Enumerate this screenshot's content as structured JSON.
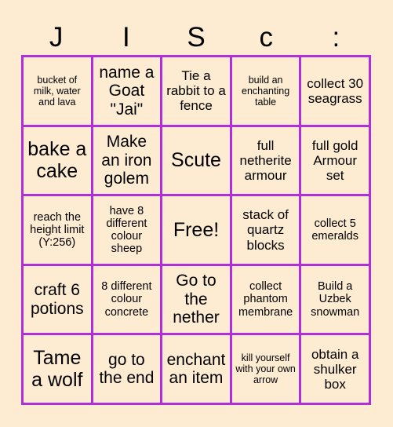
{
  "header": {
    "letters": [
      "J",
      "I",
      "S",
      "c",
      ":"
    ]
  },
  "grid": {
    "columns": 5,
    "rows": 5,
    "border_color": "#b02fd8",
    "background_color": "#fdecd2",
    "text_color": "#000000",
    "cells": [
      {
        "text": "bucket of milk, water and lava",
        "size": "fs-xs"
      },
      {
        "text": "name a Goat \"Jai\"",
        "size": "fs-l"
      },
      {
        "text": "Tie a rabbit to a fence",
        "size": "fs-m"
      },
      {
        "text": "build an enchanting table",
        "size": "fs-xs"
      },
      {
        "text": "collect 30 seagrass",
        "size": "fs-m"
      },
      {
        "text": "bake a cake",
        "size": "fs-xl"
      },
      {
        "text": "Make an iron golem",
        "size": "fs-l"
      },
      {
        "text": "Scute",
        "size": "fs-xl"
      },
      {
        "text": "full netherite armour",
        "size": "fs-m"
      },
      {
        "text": "full gold Armour set",
        "size": "fs-m"
      },
      {
        "text": "reach the height limit (Y:256)",
        "size": "fs-s"
      },
      {
        "text": "have 8 different colour sheep",
        "size": "fs-s"
      },
      {
        "text": "Free!",
        "size": "fs-xl"
      },
      {
        "text": "stack of quartz blocks",
        "size": "fs-m"
      },
      {
        "text": "collect 5 emeralds",
        "size": "fs-s"
      },
      {
        "text": "craft 6 potions",
        "size": "fs-l"
      },
      {
        "text": "8 different colour concrete",
        "size": "fs-s"
      },
      {
        "text": "Go to the nether",
        "size": "fs-l"
      },
      {
        "text": "collect phantom membrane",
        "size": "fs-s"
      },
      {
        "text": "Build a Uzbek snowman",
        "size": "fs-s"
      },
      {
        "text": "Tame a wolf",
        "size": "fs-xl"
      },
      {
        "text": "go to the end",
        "size": "fs-l"
      },
      {
        "text": "enchant an item",
        "size": "fs-l"
      },
      {
        "text": "kill yourself with your own arrow",
        "size": "fs-xs"
      },
      {
        "text": "obtain a shulker box",
        "size": "fs-m"
      }
    ]
  }
}
